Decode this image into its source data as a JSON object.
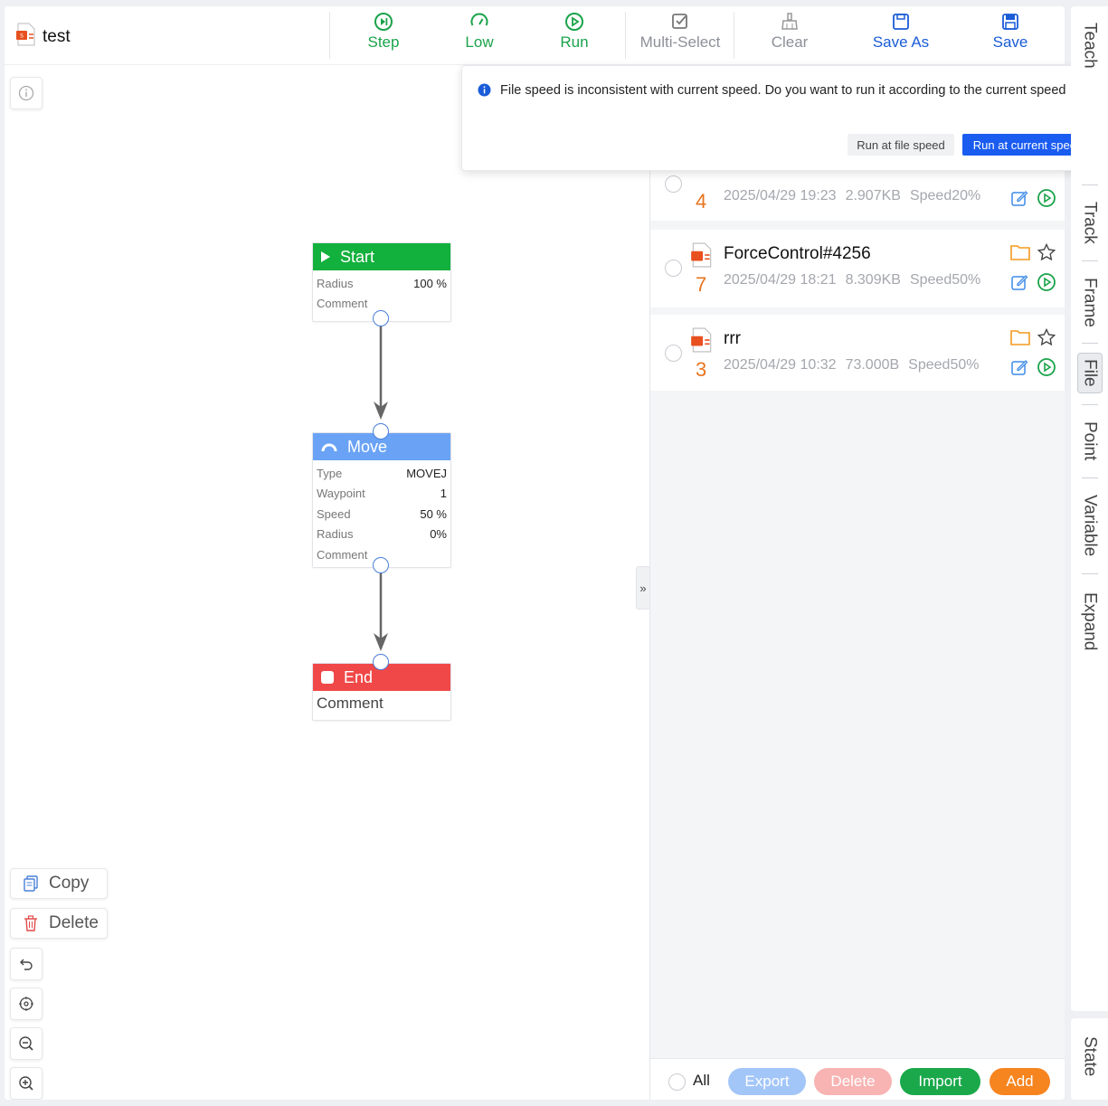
{
  "header": {
    "title": "test"
  },
  "toolbar": {
    "step": "Step",
    "low": "Low",
    "run": "Run",
    "multi_select": "Multi-Select",
    "clear": "Clear",
    "save_as": "Save As",
    "save": "Save"
  },
  "nodes": {
    "start": {
      "title": "Start",
      "radius_label": "Radius",
      "radius_value": "100 %",
      "comment_label": "Comment"
    },
    "move": {
      "title": "Move",
      "type_label": "Type",
      "type_value": "MOVEJ",
      "waypoint_label": "Waypoint",
      "waypoint_value": "1",
      "speed_label": "Speed",
      "speed_value": "50 %",
      "radius_label": "Radius",
      "radius_value": "0%",
      "comment_label": "Comment"
    },
    "end": {
      "title": "End",
      "comment_label": "Comment"
    }
  },
  "left_actions": {
    "copy": "Copy",
    "delete": "Delete"
  },
  "popup": {
    "message": "File speed is inconsistent with current speed. Do you want to run it according to the current speed",
    "file_speed_button": "Run at file speed",
    "current_speed_button": "Run at current speed"
  },
  "files": [
    {
      "name": "",
      "number": "4",
      "date": "2025/04/29 19:23",
      "size": "2.907KB",
      "speed": "Speed20%"
    },
    {
      "name": "ForceControl#4256",
      "number": "7",
      "date": "2025/04/29 18:21",
      "size": "8.309KB",
      "speed": "Speed50%"
    },
    {
      "name": "rrr",
      "number": "3",
      "date": "2025/04/29 10:32",
      "size": "73.000B",
      "speed": "Speed50%"
    }
  ],
  "bottom": {
    "all": "All",
    "export": "Export",
    "delete": "Delete",
    "import": "Import",
    "add": "Add"
  },
  "tabs": [
    "Teach",
    "Track",
    "Frame",
    "File",
    "Point",
    "Variable",
    "Expand"
  ],
  "state_tab": "State",
  "colors": {
    "accent_blue": "#1a5cd8",
    "green": "#1aa34a",
    "start": "#12b03c",
    "move": "#6aa3f5",
    "end": "#f04848",
    "orange": "#f6841f"
  }
}
